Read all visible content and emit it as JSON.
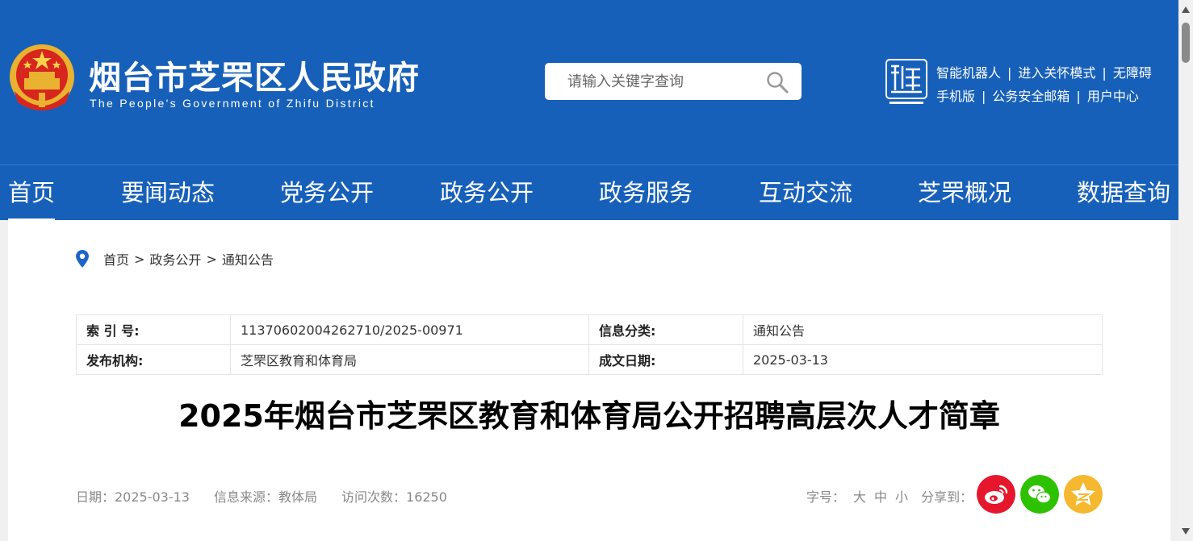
{
  "header": {
    "site_title": "烟台市芝罘区人民政府",
    "site_subtitle": "The People's Government of Zhifu District",
    "search": {
      "placeholder": "请输入关键字查询"
    },
    "top_links_row1": [
      "智能机器人",
      "进入关怀模式",
      "无障碍"
    ],
    "top_links_row2": [
      "手机版",
      "公务安全邮箱",
      "用户中心"
    ],
    "separator": "|"
  },
  "nav": {
    "items": [
      "首页",
      "要闻动态",
      "党务公开",
      "政务公开",
      "政务服务",
      "互动交流",
      "芝罘概况",
      "数据查询"
    ],
    "active_index": 0
  },
  "breadcrumb": {
    "items": [
      "首页",
      "政务公开",
      "通知公告"
    ],
    "separator": ">"
  },
  "info_table": {
    "rows": [
      {
        "label1": "索 引 号:",
        "value1": "11370602004262710/2025-00971",
        "label2": "信息分类:",
        "value2": "通知公告"
      },
      {
        "label1": "发布机构:",
        "value1": "芝罘区教育和体育局",
        "label2": "成文日期:",
        "value2": "2025-03-13"
      }
    ]
  },
  "article": {
    "title": "2025年烟台市芝罘区教育和体育局公开招聘高层次人才简章",
    "date": "日期：2025-03-13",
    "source": "信息来源：教体局",
    "visits": "访问次数：16250"
  },
  "tools": {
    "font_size_label": "字号：",
    "sizes": [
      "大",
      "中",
      "小"
    ],
    "share_label": "分享到：",
    "share_icons": [
      "weibo-icon",
      "wechat-icon",
      "qzone-icon"
    ]
  },
  "colors": {
    "header_blue": "#1760b9",
    "weibo_red": "#e6162d",
    "wechat_green": "#2dc100",
    "qzone_yellow": "#f5b82e",
    "pin_blue": "#1e64c8"
  }
}
